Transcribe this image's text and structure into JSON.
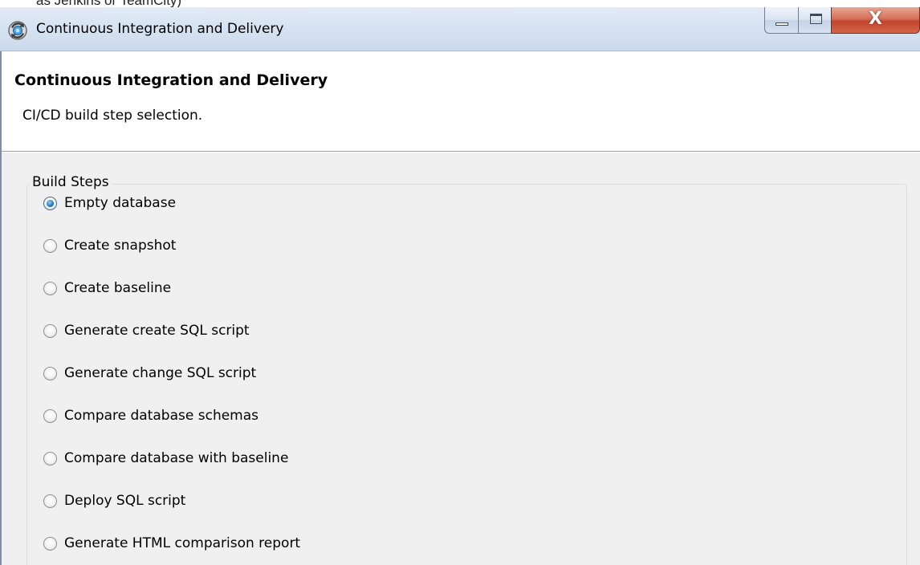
{
  "background_text": "as Jenkins or TeamCity)",
  "window": {
    "title": "Continuous Integration and Delivery",
    "icon": "gear-sync-icon",
    "close_glyph": "X"
  },
  "header": {
    "title": "Continuous Integration and Delivery",
    "description": "CI/CD build step selection."
  },
  "build_steps": {
    "legend": "Build Steps",
    "selected_index": 0,
    "options": [
      "Empty database",
      "Create snapshot",
      "Create baseline",
      "Generate create SQL script",
      "Generate change SQL script",
      "Compare database schemas",
      "Compare database with baseline",
      "Deploy SQL script",
      "Generate HTML comparison report"
    ]
  },
  "colors": {
    "content_background": "#f0f0f0",
    "close_button": "#c2452d",
    "radio_selected": "#2a7cc4"
  }
}
